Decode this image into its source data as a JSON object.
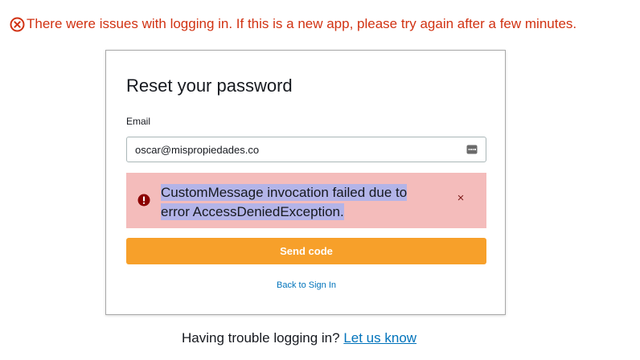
{
  "top_error": {
    "icon": "error-circle-x-icon",
    "message": "There were issues with logging in. If this is a new app, please try again after a few minutes.",
    "color": "#d13212"
  },
  "card": {
    "title": "Reset your password",
    "email_label": "Email",
    "email_value": "oscar@mispropiedades.co",
    "autofill_icon": "autofill-key-icon",
    "alert": {
      "icon": "error-exclamation-icon",
      "message": "CustomMessage invocation failed due to error AccessDeniedException.",
      "close_icon": "close-icon",
      "close_glyph": "×",
      "background": "#f4bcbb"
    },
    "send_button_label": "Send code",
    "send_button_color": "#f7a02a",
    "back_link_label": "Back to Sign In"
  },
  "footer": {
    "trouble_text": "Having trouble logging in?",
    "link_label": "Let us know"
  }
}
